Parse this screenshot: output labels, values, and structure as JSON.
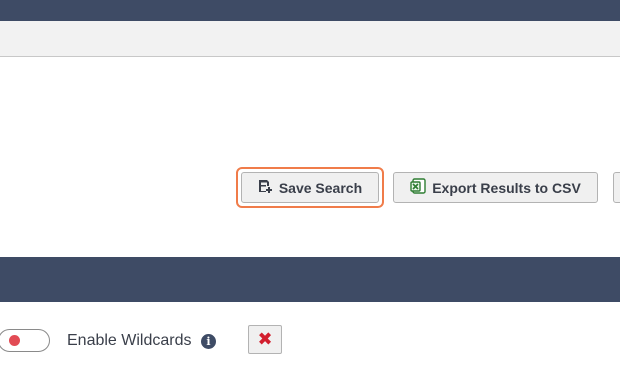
{
  "toolbar": {
    "save_search_label": "Save Search",
    "export_csv_label": "Export Results to CSV"
  },
  "options": {
    "enable_wildcards_label": "Enable Wildcards",
    "enable_wildcards_on": false
  },
  "icons": {
    "save": "save-icon",
    "excel": "excel-icon",
    "info": "info-icon",
    "clear": "close-icon"
  },
  "colors": {
    "header": "#3e4b65",
    "focus": "#f07c4a",
    "toggle_off": "#e24b54",
    "clear": "#d21f2e"
  }
}
